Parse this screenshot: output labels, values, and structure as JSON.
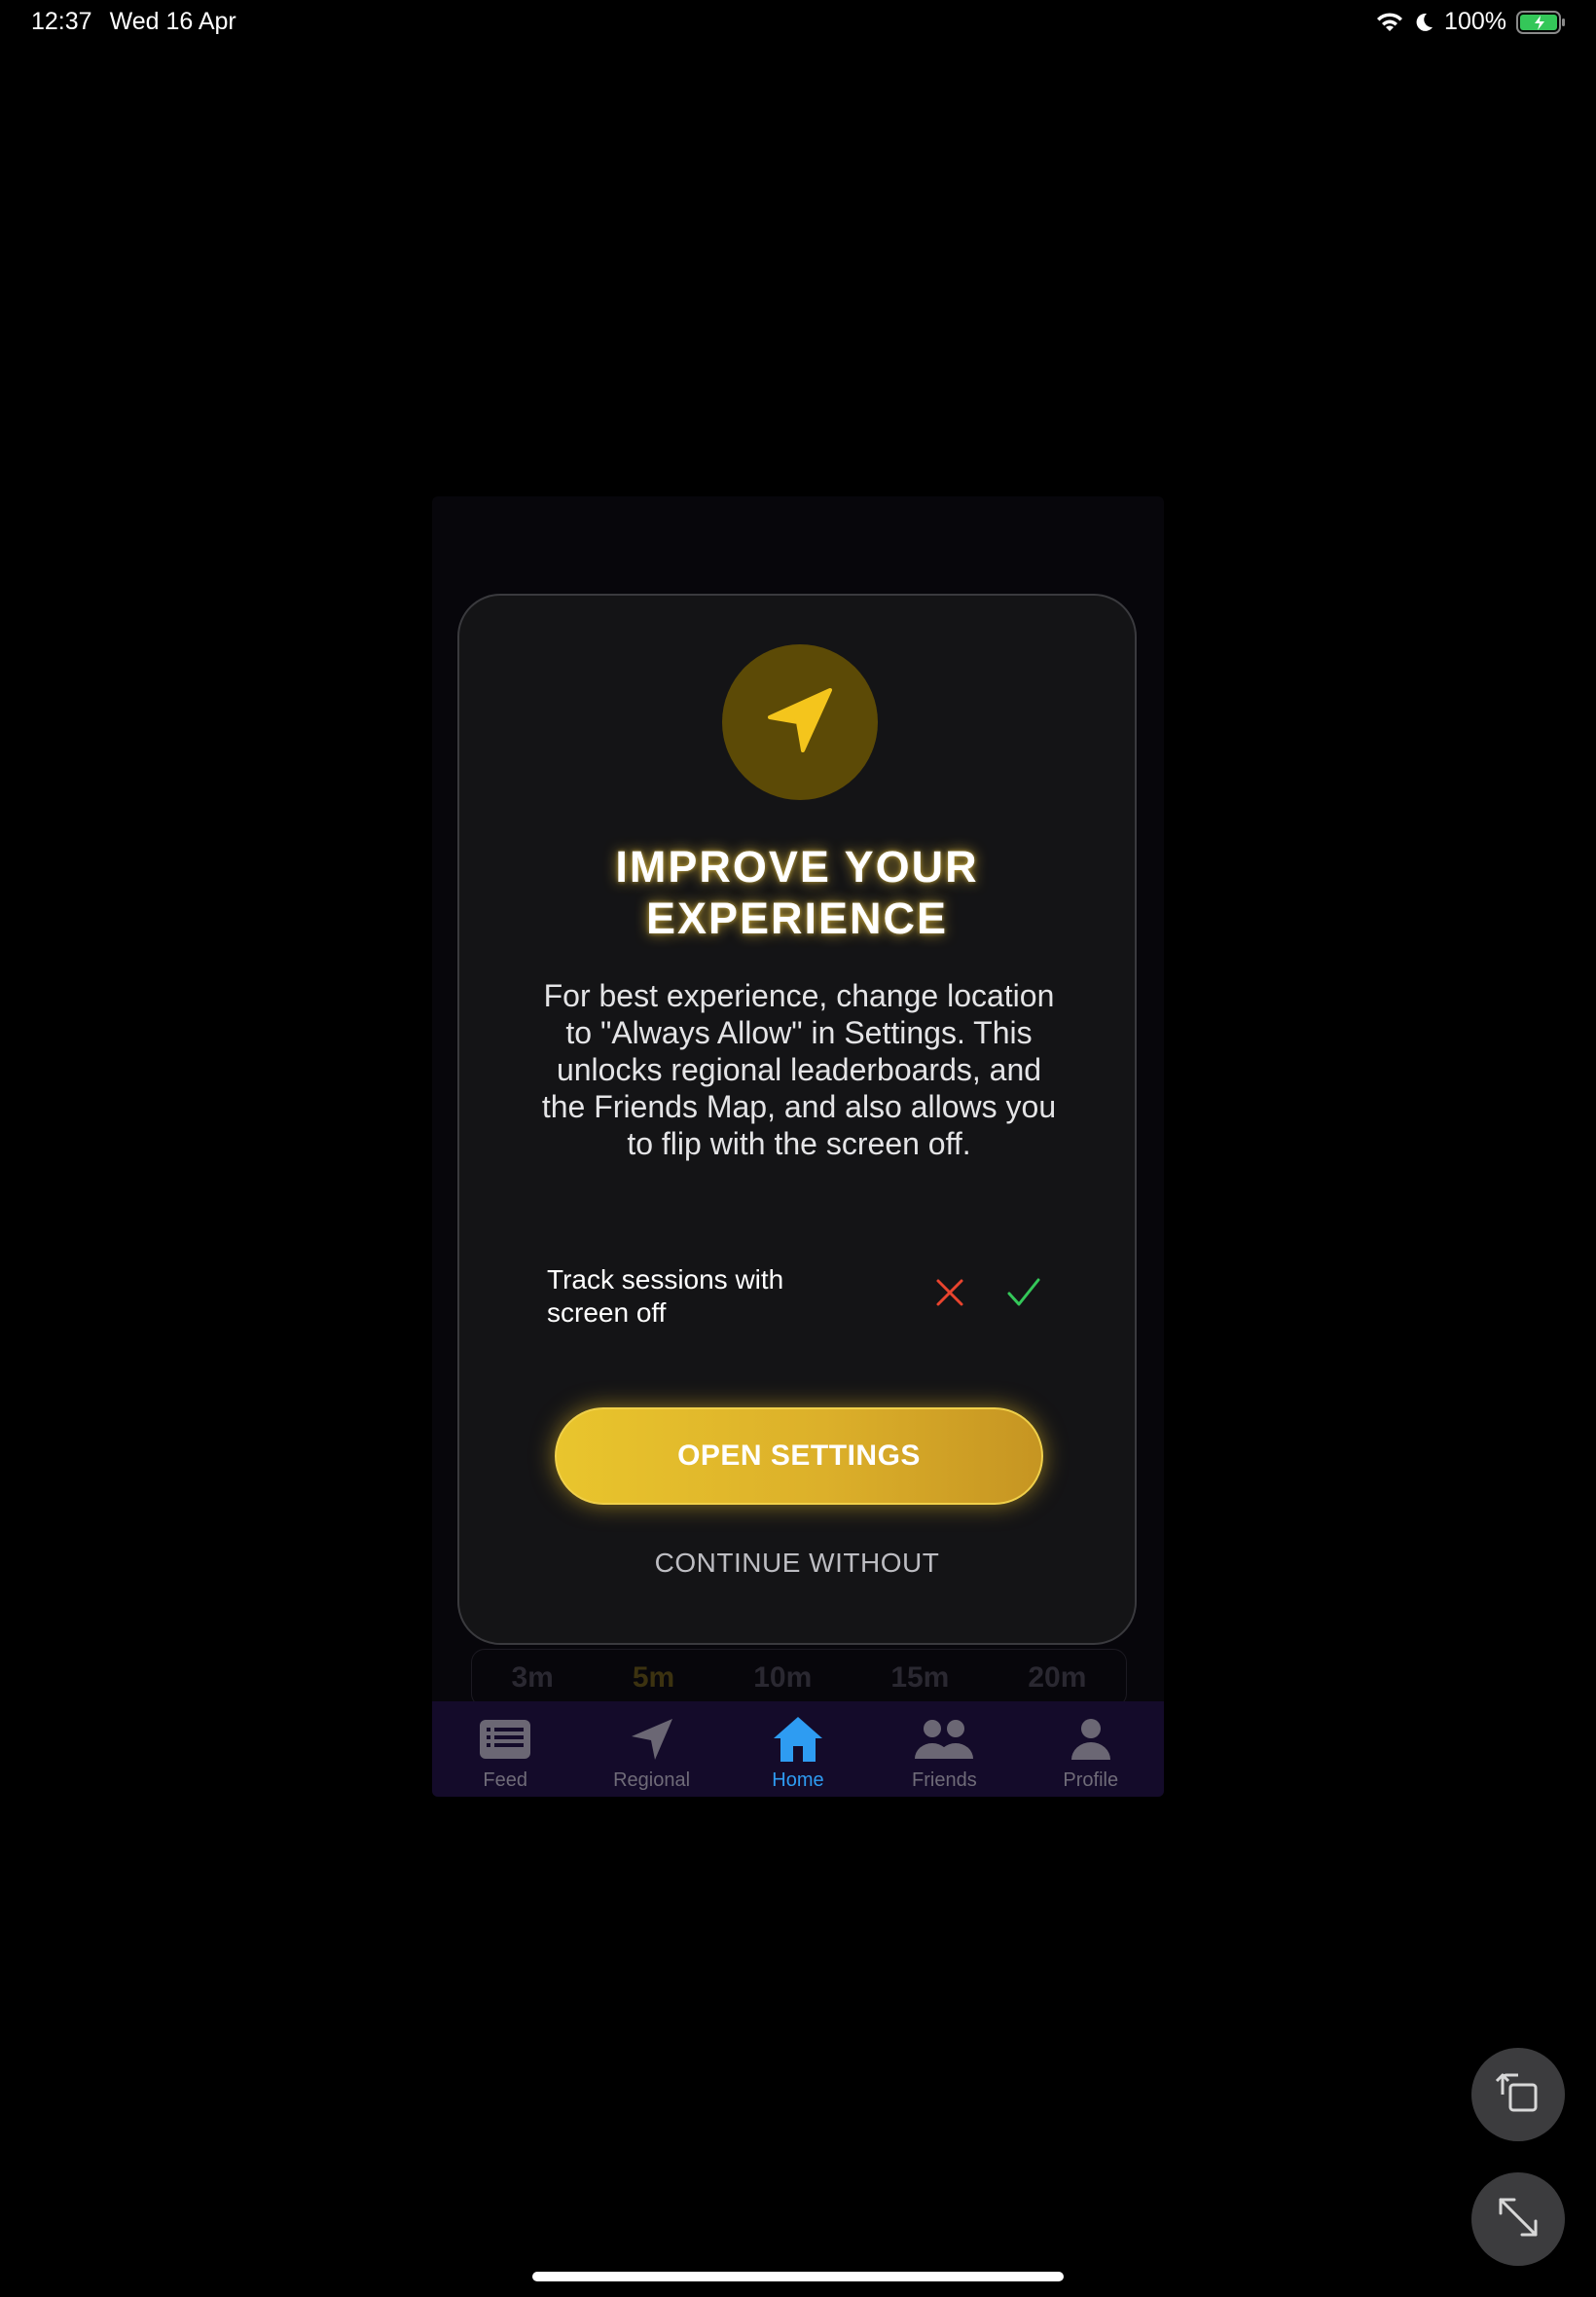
{
  "status_bar": {
    "time": "12:37",
    "date": "Wed 16 Apr",
    "battery_text": "100%",
    "icons": [
      "wifi-icon",
      "moon-icon",
      "battery-charging-icon"
    ]
  },
  "background_app": {
    "duration_options": [
      "3m",
      "5m",
      "10m",
      "15m",
      "20m"
    ],
    "selected_duration": "5m",
    "tabs": [
      {
        "label": "Feed",
        "icon": "feed-icon",
        "active": false
      },
      {
        "label": "Regional",
        "icon": "location-arrow-icon",
        "active": false
      },
      {
        "label": "Home",
        "icon": "home-icon",
        "active": true
      },
      {
        "label": "Friends",
        "icon": "friends-icon",
        "active": false
      },
      {
        "label": "Profile",
        "icon": "profile-icon",
        "active": false
      }
    ]
  },
  "modal": {
    "icon": "location-arrow-icon",
    "title_line1": "IMPROVE YOUR",
    "title_line2": "EXPERIENCE",
    "body": "For best experience, change location to \"Always Allow\" in Settings. This unlocks regional leaderboards, and the Friends Map, and also allows you to flip with the screen off.",
    "track_label_line1": "Track sessions with",
    "track_label_line2": "screen off",
    "primary_button": "OPEN SETTINGS",
    "secondary_button": "CONTINUE WITHOUT"
  },
  "colors": {
    "accent_gold": "#e9c52d",
    "active_tab": "#2e9cf2",
    "x_red": "#e8442e",
    "check_green": "#34c759"
  }
}
